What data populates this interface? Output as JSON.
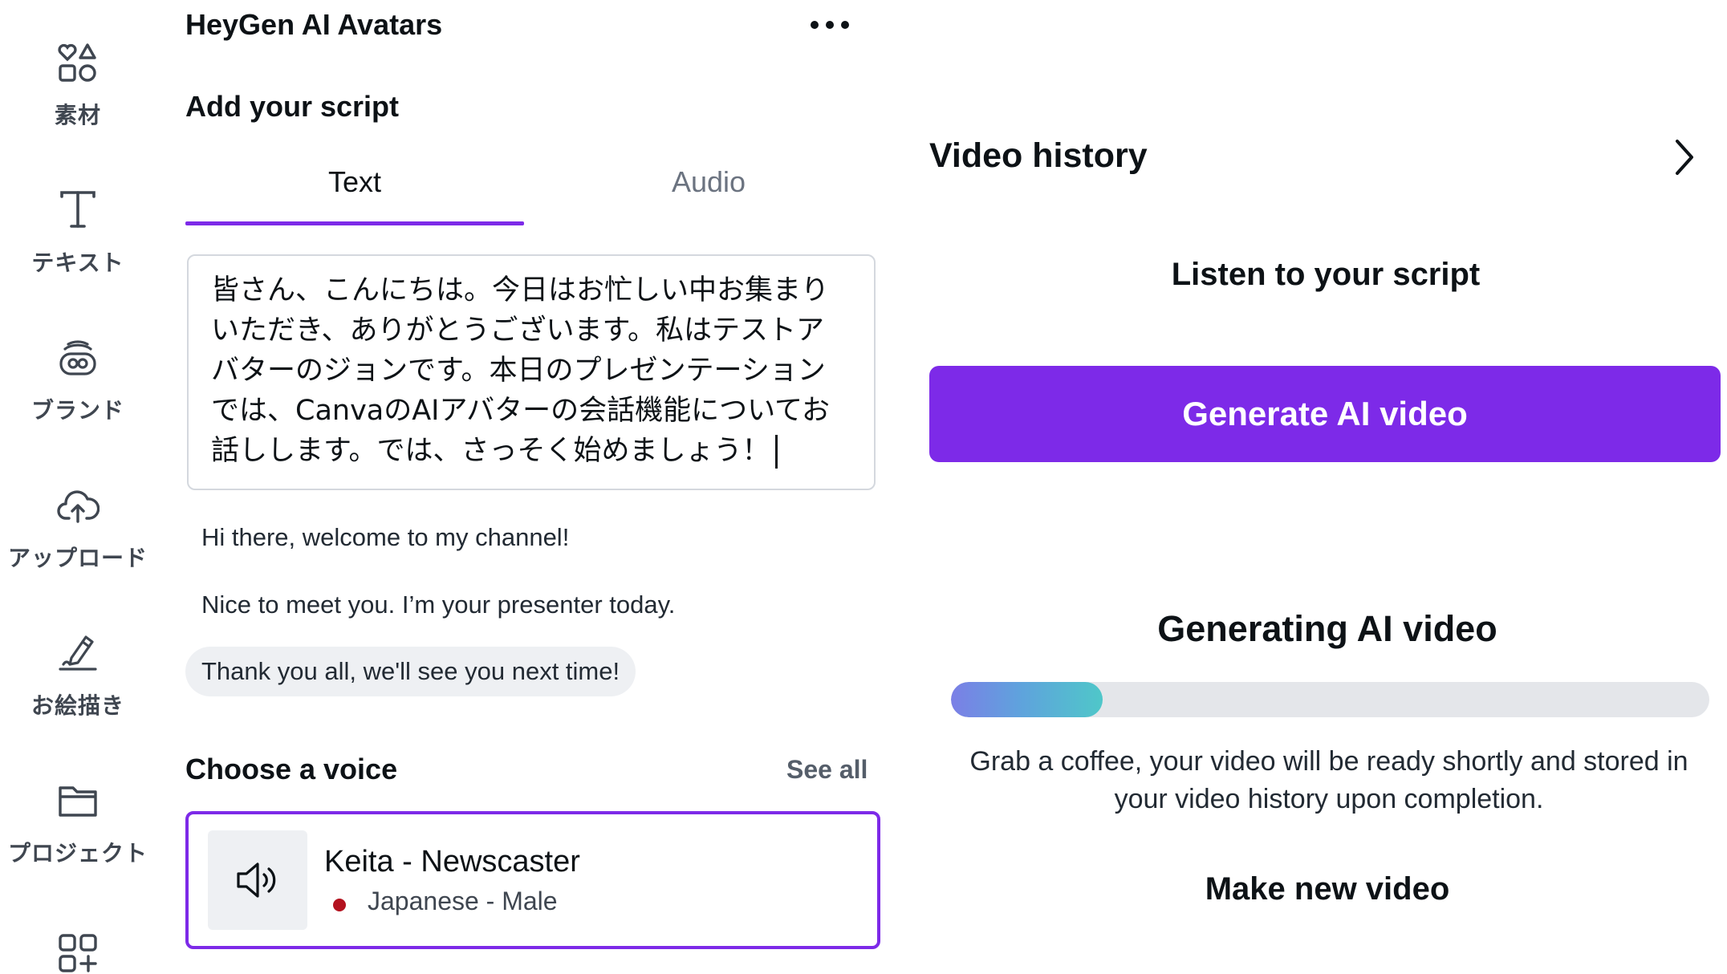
{
  "rail": {
    "items": [
      {
        "label": "素材",
        "icon": "elements-icon"
      },
      {
        "label": "テキスト",
        "icon": "text-icon"
      },
      {
        "label": "ブランド",
        "icon": "brand-icon"
      },
      {
        "label": "アップロード",
        "icon": "upload-cloud-icon"
      },
      {
        "label": "お絵描き",
        "icon": "draw-pen-icon"
      },
      {
        "label": "プロジェクト",
        "icon": "folder-icon"
      },
      {
        "label": "",
        "icon": "apps-icon"
      }
    ]
  },
  "panel": {
    "title": "HeyGen AI Avatars",
    "script_heading": "Add your script",
    "tabs": [
      {
        "label": "Text",
        "active": true
      },
      {
        "label": "Audio",
        "active": false
      }
    ],
    "script_lines": [
      "皆さん、こんにちは。今日はお忙しい中お集まり",
      "いただき、ありがとうございます。私はテストア",
      "バターのジョンです。本日のプレゼンテーション",
      "では、CanvaのAIアバターの会話機能についてお",
      "話しします。では、さっそく始めましょう！"
    ],
    "suggestions": [
      "Hi there, welcome to my channel!",
      "Nice to meet you. I’m your presenter today.",
      "Thank you all, we'll see you next time!"
    ],
    "voice_heading": "Choose a voice",
    "see_all": "See all",
    "voice": {
      "name": "Keita - Newscaster",
      "language": "Japanese - Male",
      "icon": "speaker-icon",
      "flag_color": "#b3121f"
    }
  },
  "right": {
    "history_title": "Video history",
    "listen_label": "Listen to your script",
    "generate_label": "Generate AI video",
    "generating_title": "Generating AI video",
    "progress": 0.2,
    "note": "Grab a coffee, your video will be ready shortly and stored in your video history upon completion.",
    "make_new_label": "Make new video"
  },
  "colors": {
    "accent": "#7d2ae8",
    "progress_gradient": [
      "#7b7fe6",
      "#5fa2dd",
      "#4fc7c9"
    ]
  }
}
